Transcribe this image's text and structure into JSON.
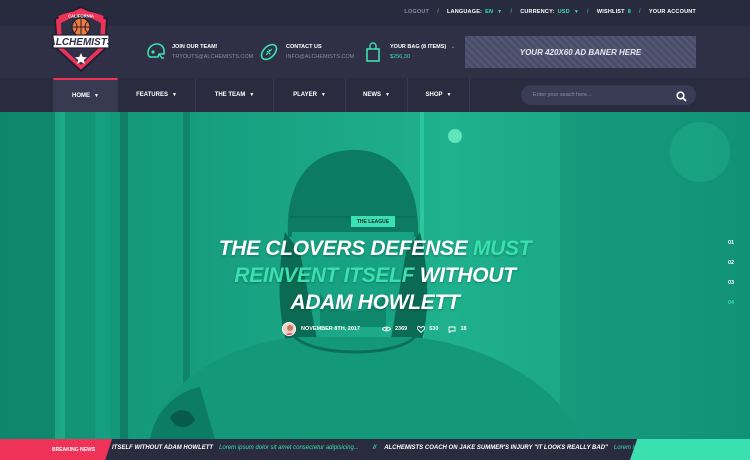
{
  "top": {
    "logout": "LOGOUT",
    "language_label": "LANGUAGE:",
    "language_value": "EN",
    "currency_label": "CURRENCY:",
    "currency_value": "USD",
    "wishlist_label": "WISHLIST",
    "wishlist_value": "8",
    "account": "YOUR ACCOUNT"
  },
  "brand": {
    "ribbon": "CALIFORNIA",
    "name": "ALCHEMISTS"
  },
  "header": {
    "join_title": "JOIN OUR TEAM!",
    "join_email": "TRYOUTS@ALCHEMISTS.COM",
    "contact_title": "CONTACT US",
    "contact_email": "INFO@ALCHEMISTS.COM",
    "bag_title": "YOUR BAG (8 ITEMS)",
    "bag_total": "$256,30",
    "ad": "YOUR 420X60 AD BANER HERE"
  },
  "nav": [
    {
      "label": "HOME"
    },
    {
      "label": "FEATURES"
    },
    {
      "label": "THE TEAM"
    },
    {
      "label": "PLAYER"
    },
    {
      "label": "NEWS"
    },
    {
      "label": "SHOP"
    }
  ],
  "search": {
    "placeholder": "Enter your seach here..."
  },
  "hero": {
    "category": "THE LEAGUE",
    "title_1": "THE CLOVERS DEFENSE",
    "title_2": "MUST",
    "title_3": "REINVENT ITSELF",
    "title_4": "WITHOUT",
    "title_5": "ADAM HOWLETT",
    "date": "NOVEMBER 8TH, 2017",
    "views": "2369",
    "likes": "530",
    "comments": "18",
    "slides": [
      "01",
      "02",
      "03",
      "04"
    ],
    "active_slide": "04"
  },
  "ticker": {
    "label": "BREAKING NEWS",
    "item1_title": "ITSELF WITHOUT ADAM HOWLETT",
    "item1_text": "Lorem ipsum dolor sit amet consectetur adipisicing...",
    "separator": "//",
    "item2_title": "ALCHEMISTS COACH ON JAKE SUMMER'S INJURY \"IT LOOKS REALLY BAD\"",
    "item2_text": "Lorem ipsum dolor"
  },
  "colors": {
    "accent_green": "#3be0b0",
    "accent_red": "#ef3258",
    "bg_dark": "#2a2b3e"
  }
}
